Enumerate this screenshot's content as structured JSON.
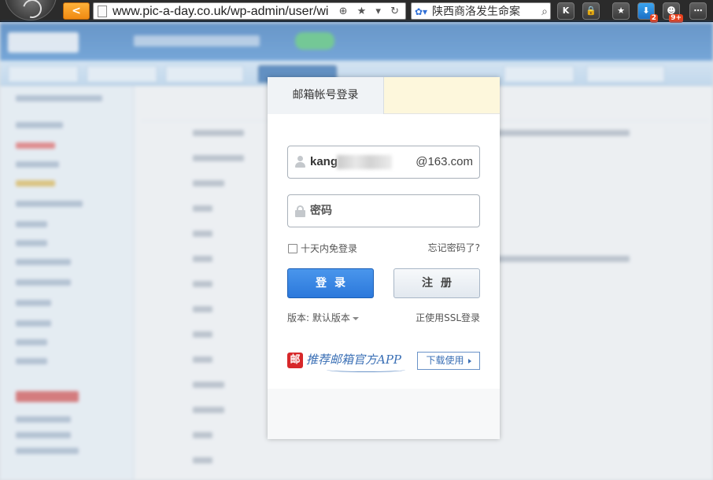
{
  "browser": {
    "url": "www.pic-a-day.co.uk/wp-admin/user/wi",
    "search_text": "陕西商洛发生命案",
    "extensions": [
      {
        "icon": "k-icon",
        "glyph": "K",
        "badge": ""
      },
      {
        "icon": "lock-icon",
        "glyph": "🔒",
        "badge": ""
      },
      {
        "icon": "star-icon",
        "glyph": "★",
        "badge": ""
      },
      {
        "icon": "download-icon",
        "glyph": "⬇",
        "badge": "2"
      },
      {
        "icon": "game-icon",
        "glyph": "☻",
        "badge": "9+"
      },
      {
        "icon": "more-icon",
        "glyph": "⋯",
        "badge": ""
      }
    ]
  },
  "login": {
    "tab_label": "邮箱帐号登录",
    "username_visible": "kang",
    "domain": "@163.com",
    "password_placeholder": "密码",
    "remember_label": "十天内免登录",
    "forgot_label": "忘记密码了?",
    "login_button": "登录",
    "register_button": "注册",
    "version_label": "版本: 默认版本",
    "ssl_label": "正使用SSL登录",
    "app_logo": "邮",
    "app_promo": "推荐邮箱官方APP",
    "download_button": "下载使用"
  },
  "colors": {
    "primary_button": "#2b78db",
    "tab_highlight": "#fdf7dc",
    "browser_back": "#f08a12"
  }
}
